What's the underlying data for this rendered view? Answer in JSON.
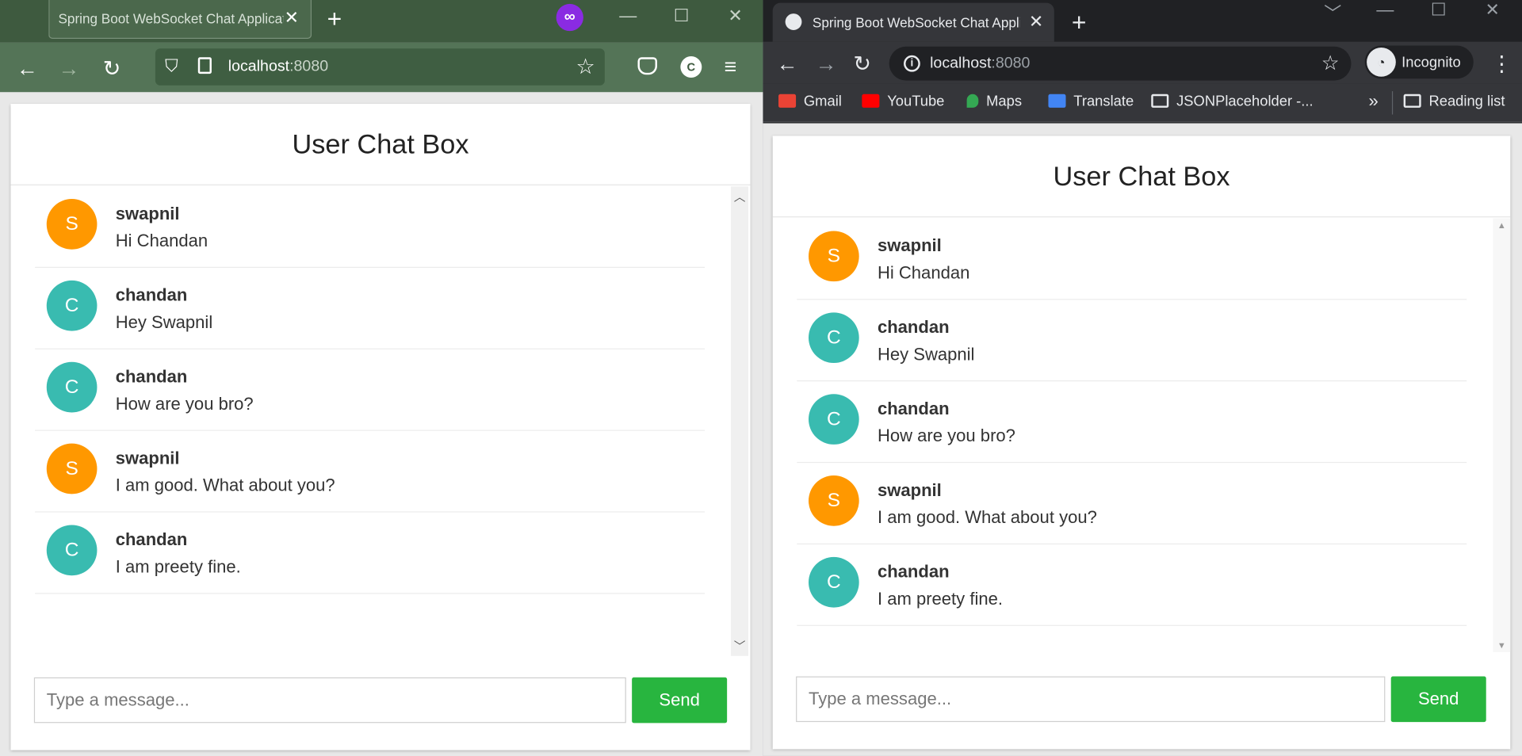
{
  "colors": {
    "avatar_s": "#ff9800",
    "avatar_c": "#39bbb0",
    "send_button": "#28b53f"
  },
  "left_window": {
    "tab_title": "Spring Boot WebSocket Chat Application",
    "url_host": "localhost",
    "url_port": ":8080",
    "account_initial": "C"
  },
  "right_window": {
    "tab_title": "Spring Boot WebSocket Chat Application",
    "url_host": "localhost",
    "url_port": ":8080",
    "profile_label": "Incognito",
    "bookmarks": [
      "Gmail",
      "YouTube",
      "Maps",
      "Translate",
      "JSONPlaceholder -...",
      "Reading list"
    ]
  },
  "chat": {
    "title": "User Chat Box",
    "placeholder": "Type a message...",
    "send_label": "Send",
    "messages": [
      {
        "initial": "S",
        "sender": "swapnil",
        "text": "Hi Chandan",
        "color": "#ff9800"
      },
      {
        "initial": "C",
        "sender": "chandan",
        "text": "Hey Swapnil",
        "color": "#39bbb0"
      },
      {
        "initial": "C",
        "sender": "chandan",
        "text": "How are you bro?",
        "color": "#39bbb0"
      },
      {
        "initial": "S",
        "sender": "swapnil",
        "text": "I am good. What about you?",
        "color": "#ff9800"
      },
      {
        "initial": "C",
        "sender": "chandan",
        "text": "I am preety fine.",
        "color": "#39bbb0"
      }
    ]
  }
}
